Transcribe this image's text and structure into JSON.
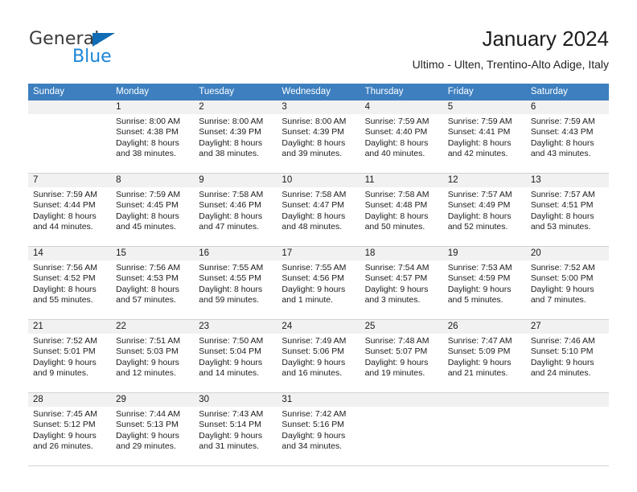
{
  "brand": {
    "name_top": "General",
    "name_bottom": "Blue",
    "triangle_color": "#0f6cb5",
    "blue_color": "#1b85d6"
  },
  "header": {
    "title": "January 2024",
    "subtitle": "Ultimo - Ulten, Trentino-Alto Adige, Italy"
  },
  "theme": {
    "header_row_bg": "#3d7fbf",
    "day_number_bg": "#f1f1f1",
    "grid_line": "#d2d2d2",
    "text": "#1c1c1c"
  },
  "weekdays": [
    "Sunday",
    "Monday",
    "Tuesday",
    "Wednesday",
    "Thursday",
    "Friday",
    "Saturday"
  ],
  "weeks": [
    [
      {
        "day": "",
        "blank": true,
        "sunrise": "",
        "sunset": "",
        "daylight1": "",
        "daylight2": ""
      },
      {
        "day": "1",
        "sunrise": "Sunrise: 8:00 AM",
        "sunset": "Sunset: 4:38 PM",
        "daylight1": "Daylight: 8 hours",
        "daylight2": "and 38 minutes."
      },
      {
        "day": "2",
        "sunrise": "Sunrise: 8:00 AM",
        "sunset": "Sunset: 4:39 PM",
        "daylight1": "Daylight: 8 hours",
        "daylight2": "and 38 minutes."
      },
      {
        "day": "3",
        "sunrise": "Sunrise: 8:00 AM",
        "sunset": "Sunset: 4:39 PM",
        "daylight1": "Daylight: 8 hours",
        "daylight2": "and 39 minutes."
      },
      {
        "day": "4",
        "sunrise": "Sunrise: 7:59 AM",
        "sunset": "Sunset: 4:40 PM",
        "daylight1": "Daylight: 8 hours",
        "daylight2": "and 40 minutes."
      },
      {
        "day": "5",
        "sunrise": "Sunrise: 7:59 AM",
        "sunset": "Sunset: 4:41 PM",
        "daylight1": "Daylight: 8 hours",
        "daylight2": "and 42 minutes."
      },
      {
        "day": "6",
        "sunrise": "Sunrise: 7:59 AM",
        "sunset": "Sunset: 4:43 PM",
        "daylight1": "Daylight: 8 hours",
        "daylight2": "and 43 minutes."
      }
    ],
    [
      {
        "day": "7",
        "sunrise": "Sunrise: 7:59 AM",
        "sunset": "Sunset: 4:44 PM",
        "daylight1": "Daylight: 8 hours",
        "daylight2": "and 44 minutes."
      },
      {
        "day": "8",
        "sunrise": "Sunrise: 7:59 AM",
        "sunset": "Sunset: 4:45 PM",
        "daylight1": "Daylight: 8 hours",
        "daylight2": "and 45 minutes."
      },
      {
        "day": "9",
        "sunrise": "Sunrise: 7:58 AM",
        "sunset": "Sunset: 4:46 PM",
        "daylight1": "Daylight: 8 hours",
        "daylight2": "and 47 minutes."
      },
      {
        "day": "10",
        "sunrise": "Sunrise: 7:58 AM",
        "sunset": "Sunset: 4:47 PM",
        "daylight1": "Daylight: 8 hours",
        "daylight2": "and 48 minutes."
      },
      {
        "day": "11",
        "sunrise": "Sunrise: 7:58 AM",
        "sunset": "Sunset: 4:48 PM",
        "daylight1": "Daylight: 8 hours",
        "daylight2": "and 50 minutes."
      },
      {
        "day": "12",
        "sunrise": "Sunrise: 7:57 AM",
        "sunset": "Sunset: 4:49 PM",
        "daylight1": "Daylight: 8 hours",
        "daylight2": "and 52 minutes."
      },
      {
        "day": "13",
        "sunrise": "Sunrise: 7:57 AM",
        "sunset": "Sunset: 4:51 PM",
        "daylight1": "Daylight: 8 hours",
        "daylight2": "and 53 minutes."
      }
    ],
    [
      {
        "day": "14",
        "sunrise": "Sunrise: 7:56 AM",
        "sunset": "Sunset: 4:52 PM",
        "daylight1": "Daylight: 8 hours",
        "daylight2": "and 55 minutes."
      },
      {
        "day": "15",
        "sunrise": "Sunrise: 7:56 AM",
        "sunset": "Sunset: 4:53 PM",
        "daylight1": "Daylight: 8 hours",
        "daylight2": "and 57 minutes."
      },
      {
        "day": "16",
        "sunrise": "Sunrise: 7:55 AM",
        "sunset": "Sunset: 4:55 PM",
        "daylight1": "Daylight: 8 hours",
        "daylight2": "and 59 minutes."
      },
      {
        "day": "17",
        "sunrise": "Sunrise: 7:55 AM",
        "sunset": "Sunset: 4:56 PM",
        "daylight1": "Daylight: 9 hours",
        "daylight2": "and 1 minute."
      },
      {
        "day": "18",
        "sunrise": "Sunrise: 7:54 AM",
        "sunset": "Sunset: 4:57 PM",
        "daylight1": "Daylight: 9 hours",
        "daylight2": "and 3 minutes."
      },
      {
        "day": "19",
        "sunrise": "Sunrise: 7:53 AM",
        "sunset": "Sunset: 4:59 PM",
        "daylight1": "Daylight: 9 hours",
        "daylight2": "and 5 minutes."
      },
      {
        "day": "20",
        "sunrise": "Sunrise: 7:52 AM",
        "sunset": "Sunset: 5:00 PM",
        "daylight1": "Daylight: 9 hours",
        "daylight2": "and 7 minutes."
      }
    ],
    [
      {
        "day": "21",
        "sunrise": "Sunrise: 7:52 AM",
        "sunset": "Sunset: 5:01 PM",
        "daylight1": "Daylight: 9 hours",
        "daylight2": "and 9 minutes."
      },
      {
        "day": "22",
        "sunrise": "Sunrise: 7:51 AM",
        "sunset": "Sunset: 5:03 PM",
        "daylight1": "Daylight: 9 hours",
        "daylight2": "and 12 minutes."
      },
      {
        "day": "23",
        "sunrise": "Sunrise: 7:50 AM",
        "sunset": "Sunset: 5:04 PM",
        "daylight1": "Daylight: 9 hours",
        "daylight2": "and 14 minutes."
      },
      {
        "day": "24",
        "sunrise": "Sunrise: 7:49 AM",
        "sunset": "Sunset: 5:06 PM",
        "daylight1": "Daylight: 9 hours",
        "daylight2": "and 16 minutes."
      },
      {
        "day": "25",
        "sunrise": "Sunrise: 7:48 AM",
        "sunset": "Sunset: 5:07 PM",
        "daylight1": "Daylight: 9 hours",
        "daylight2": "and 19 minutes."
      },
      {
        "day": "26",
        "sunrise": "Sunrise: 7:47 AM",
        "sunset": "Sunset: 5:09 PM",
        "daylight1": "Daylight: 9 hours",
        "daylight2": "and 21 minutes."
      },
      {
        "day": "27",
        "sunrise": "Sunrise: 7:46 AM",
        "sunset": "Sunset: 5:10 PM",
        "daylight1": "Daylight: 9 hours",
        "daylight2": "and 24 minutes."
      }
    ],
    [
      {
        "day": "28",
        "sunrise": "Sunrise: 7:45 AM",
        "sunset": "Sunset: 5:12 PM",
        "daylight1": "Daylight: 9 hours",
        "daylight2": "and 26 minutes."
      },
      {
        "day": "29",
        "sunrise": "Sunrise: 7:44 AM",
        "sunset": "Sunset: 5:13 PM",
        "daylight1": "Daylight: 9 hours",
        "daylight2": "and 29 minutes."
      },
      {
        "day": "30",
        "sunrise": "Sunrise: 7:43 AM",
        "sunset": "Sunset: 5:14 PM",
        "daylight1": "Daylight: 9 hours",
        "daylight2": "and 31 minutes."
      },
      {
        "day": "31",
        "sunrise": "Sunrise: 7:42 AM",
        "sunset": "Sunset: 5:16 PM",
        "daylight1": "Daylight: 9 hours",
        "daylight2": "and 34 minutes."
      },
      {
        "day": "",
        "blank": true,
        "sunrise": "",
        "sunset": "",
        "daylight1": "",
        "daylight2": ""
      },
      {
        "day": "",
        "blank": true,
        "sunrise": "",
        "sunset": "",
        "daylight1": "",
        "daylight2": ""
      },
      {
        "day": "",
        "blank": true,
        "sunrise": "",
        "sunset": "",
        "daylight1": "",
        "daylight2": ""
      }
    ]
  ]
}
